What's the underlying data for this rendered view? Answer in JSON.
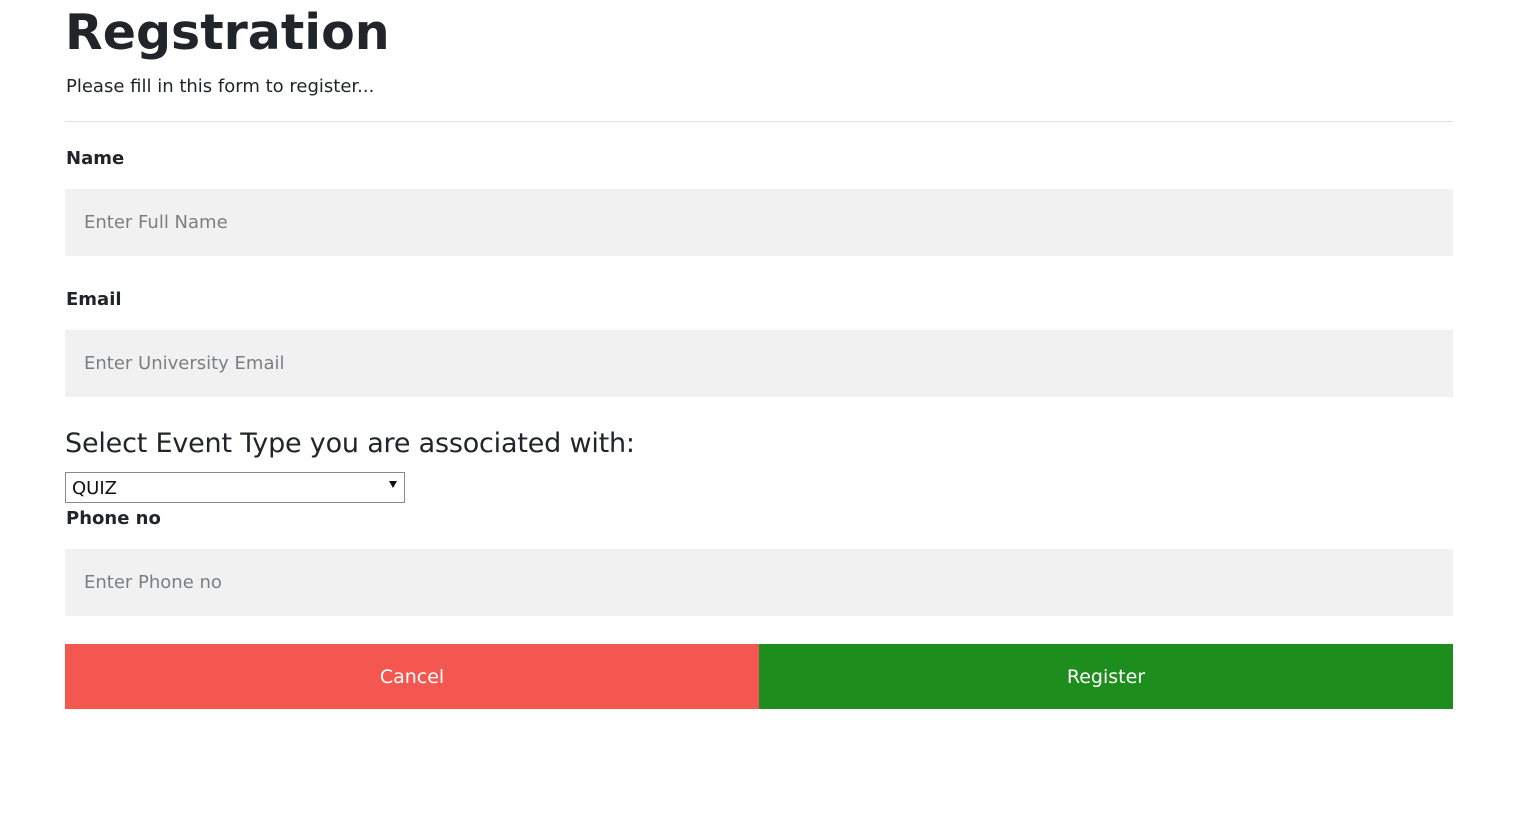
{
  "form": {
    "title": "Regstration",
    "subtitle": "Please fill in this form to register...",
    "name": {
      "label": "Name",
      "placeholder": "Enter Full Name",
      "value": ""
    },
    "email": {
      "label": "Email",
      "placeholder": "Enter University Email",
      "value": ""
    },
    "event": {
      "heading": "Select Event Type you are associated with:",
      "selected": "QUIZ"
    },
    "phone": {
      "label": "Phone no",
      "placeholder": "Enter Phone no",
      "value": ""
    },
    "buttons": {
      "cancel": "Cancel",
      "register": "Register"
    }
  },
  "colors": {
    "cancel_bg": "#f4574f",
    "register_bg": "#1d8e1d",
    "input_bg": "#f1f1f1"
  }
}
